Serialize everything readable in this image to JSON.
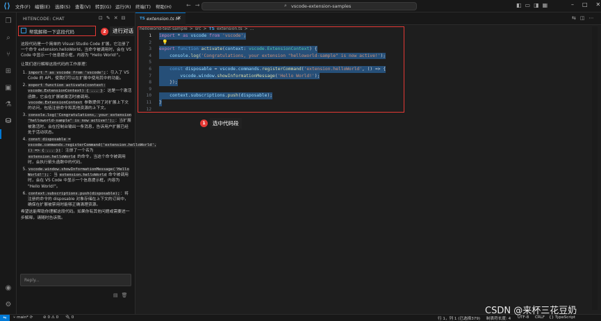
{
  "titlebar": {
    "menu": [
      "文件(F)",
      "编辑(E)",
      "选择(S)",
      "查看(V)",
      "转到(G)",
      "运行(R)",
      "终端(T)",
      "帮助(H)"
    ],
    "search_text": "vscode-extension-samples"
  },
  "sidebar": {
    "title": "HITENCODE: CHAT",
    "user_message": "帮我解释一下这段代码",
    "annotation_2_number": "2",
    "annotation_2_label": "进行对话",
    "response": {
      "intro": "这段代码是一个简单的 Visual Studio Code 扩展，它注册了一个命令 extension.helloWorld，当命令被调用时，会在 VS Code 中显示一个信息提示框，内容为 \"Hello World!\"。",
      "lead": "让我们逐行解释这段代码的工作原理：",
      "items": [
        {
          "code": "import * as vscode from 'vscode';",
          "text": "：引入了 VS Code 的 API，使我们可以在扩展中使用其中的功能。"
        },
        {
          "code": "export function activate(context: vscode.ExtensionContext) { ... }",
          "text": "：这是一个激活函数，它会在扩展被激活时被调用。",
          "code2": "vscode.ExtensionContext",
          "text2": " 参数提供了对扩展上下文的访问，包括注册命令和其他资源的上下文。"
        },
        {
          "code": "console.log('Congratulations, your extension \"helloworld-sample\" is now active!');",
          "text": "：当扩展被激活时，会在控制台输出一条消息，告诉用户扩展已经处于活动状态。"
        },
        {
          "code": "const disposable = vscode.commands.registerCommand('extension.helloWorld', () => { ... })",
          "text": "：注册了一个名为 ",
          "code2": "extension.helloWorld",
          "text2": " 的命令，当这个命令被调用时，会执行箭头函数中的代码。"
        },
        {
          "code": "vscode.window.showInformationMessage('Hello World!');",
          "text": "：当 ",
          "code2": "extension.helloWorld",
          "text2": " 命令被调用时，会在 VS Code 中显示一个信息提示框，内容为 \"Hello World!\"。"
        },
        {
          "code": "context.subscriptions.push(disposable);",
          "text": "：将注册的命令的 disposable 对象存储在上下文的订阅中，确保在扩展被禁用时能够正确清理资源。"
        }
      ],
      "outro": "希望这能帮助你理解这段代码。如果你有其他问题或需要进一步解释，请随时告诉我。"
    },
    "reply_placeholder": "Reply..."
  },
  "editor": {
    "tab_icon": "TS",
    "tab_label": "extension.ts",
    "tab_modified": "M",
    "breadcrumb": [
      "helloworld-test-sample",
      ">",
      "src",
      ">",
      "TS",
      "extension.ts",
      ">",
      "..."
    ],
    "lines": [
      {
        "n": "1",
        "segments": [
          [
            "kw2",
            "import"
          ],
          [
            "",
            " * "
          ],
          [
            "kw2",
            "as"
          ],
          [
            "var",
            " vscode "
          ],
          [
            "kw2",
            "from"
          ],
          [
            "str",
            " 'vscode'"
          ],
          [
            "",
            ";"
          ]
        ]
      },
      {
        "n": "2",
        "segments": []
      },
      {
        "n": "3",
        "segments": [
          [
            "kw2",
            "export"
          ],
          [
            "kw",
            " function "
          ],
          [
            "fn",
            "activate"
          ],
          [
            "",
            "("
          ],
          [
            "var",
            "context"
          ],
          [
            "",
            ": "
          ],
          [
            "ty",
            "vscode.ExtensionContext"
          ],
          [
            "",
            ") {"
          ]
        ]
      },
      {
        "n": "4",
        "segments": [
          [
            "var",
            "    console"
          ],
          [
            "",
            "."
          ],
          [
            "fn",
            "log"
          ],
          [
            "",
            "("
          ],
          [
            "str",
            "'Congratulations, your extension \"helloworld-sample\" is now active!'"
          ],
          [
            "",
            ");"
          ]
        ]
      },
      {
        "n": "5",
        "segments": []
      },
      {
        "n": "6",
        "segments": [
          [
            "kw",
            "    const "
          ],
          [
            "var",
            "disposable"
          ],
          [
            "",
            " = "
          ],
          [
            "var",
            "vscode"
          ],
          [
            "",
            "."
          ],
          [
            "var",
            "commands"
          ],
          [
            "",
            "."
          ],
          [
            "fn",
            "registerCommand"
          ],
          [
            "",
            "("
          ],
          [
            "str",
            "'extension.helloWorld'"
          ],
          [
            "",
            ", () => {"
          ]
        ]
      },
      {
        "n": "7",
        "segments": [
          [
            "var",
            "        vscode"
          ],
          [
            "",
            "."
          ],
          [
            "var",
            "window"
          ],
          [
            "",
            "."
          ],
          [
            "fn",
            "showInformationMessage"
          ],
          [
            "",
            "("
          ],
          [
            "str",
            "'Hello World!'"
          ],
          [
            "",
            ");"
          ]
        ]
      },
      {
        "n": "8",
        "segments": [
          [
            "",
            "    });"
          ]
        ]
      },
      {
        "n": "9",
        "segments": []
      },
      {
        "n": "10",
        "segments": [
          [
            "var",
            "    context"
          ],
          [
            "",
            "."
          ],
          [
            "var",
            "subscriptions"
          ],
          [
            "",
            "."
          ],
          [
            "fn",
            "push"
          ],
          [
            "",
            "("
          ],
          [
            "var",
            "disposable"
          ],
          [
            "",
            ");"
          ]
        ]
      },
      {
        "n": "11",
        "segments": [
          [
            "",
            "}"
          ]
        ]
      },
      {
        "n": "12",
        "segments": []
      }
    ],
    "annotation_1_number": "1",
    "annotation_1_label": "选中代码段"
  },
  "statusbar": {
    "branch": "main*",
    "problems": "⊘ 0 ⚠ 0",
    "ports": "🔌 0",
    "position": "行 1，列 1 (已选择379)",
    "spaces": "制表符长度: 4",
    "encoding": "UTF-8",
    "eol": "CRLF",
    "language": "{} TypeScript"
  },
  "watermark": "CSDN @来杯三花豆奶"
}
